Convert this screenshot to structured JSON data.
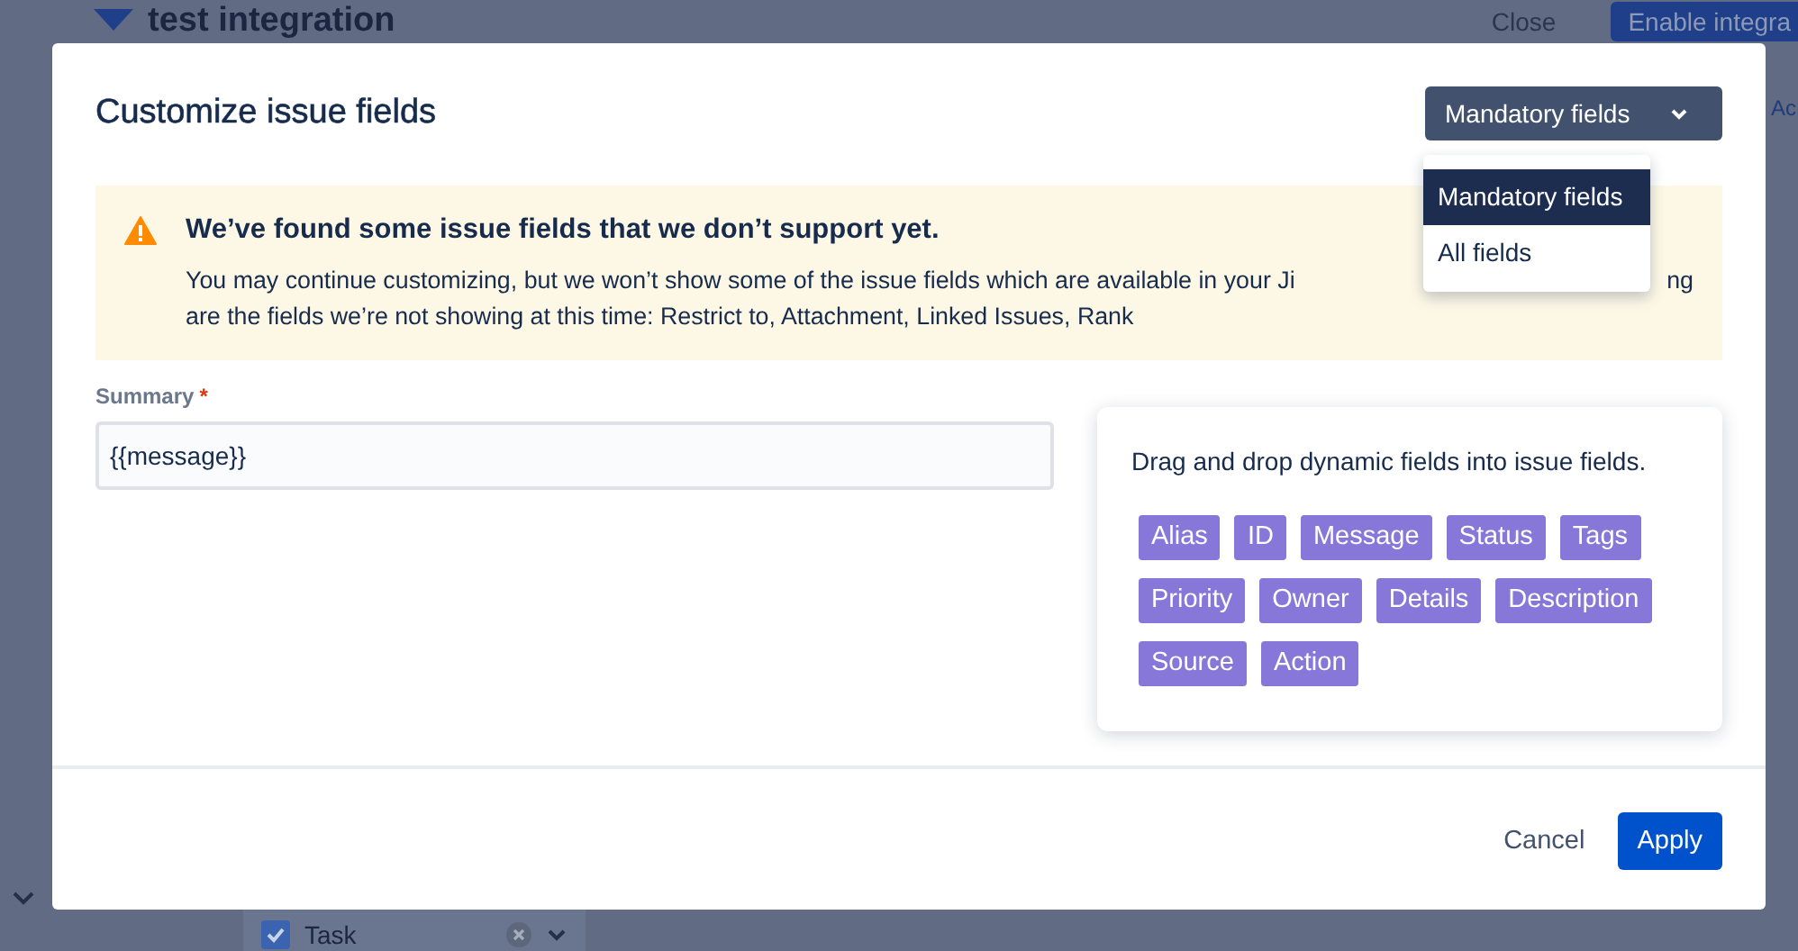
{
  "background": {
    "title": "test integration",
    "close_label": "Close",
    "enable_label": "Enable integra",
    "side_text": "Ac",
    "task_row": {
      "label": "Task",
      "checked": true
    }
  },
  "modal": {
    "title": "Customize issue fields",
    "view_select": {
      "value": "Mandatory fields"
    },
    "view_menu": [
      {
        "label": "Mandatory fields",
        "selected": true
      },
      {
        "label": "All fields",
        "selected": false
      }
    ],
    "warning": {
      "title": "We’ve found some issue fields that we don’t support yet.",
      "line_start": "You may continue customizing, but we won’t show some of the issue fields which are available in your Ji",
      "line_end": "ng",
      "line_two": "are the fields we’re not showing at this time: Restrict to, Attachment, Linked Issues, Rank"
    },
    "summary": {
      "label": "Summary",
      "required_mark": "*",
      "value": "{{message}}"
    },
    "dynamic_fields": {
      "hint": "Drag and drop dynamic fields into issue fields.",
      "tags": [
        "Alias",
        "ID",
        "Message",
        "Status",
        "Tags",
        "Priority",
        "Owner",
        "Details",
        "Description",
        "Source",
        "Action"
      ]
    },
    "cancel_label": "Cancel",
    "apply_label": "Apply"
  }
}
